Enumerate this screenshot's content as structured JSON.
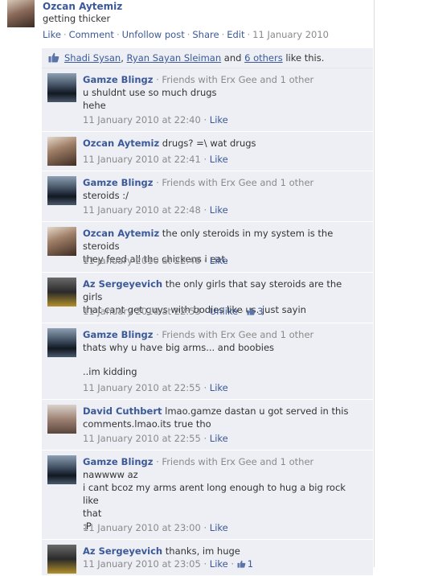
{
  "post": {
    "author": "Ozcan Aytemiz",
    "text": "getting thicker",
    "actions": [
      "Like",
      "Comment",
      "Unfollow post",
      "Share",
      "Edit"
    ],
    "date": "11 January 2010"
  },
  "likes": {
    "name1": "Shadi Sysan",
    "name2": "Ryan Sayan Sleiman",
    "connector": " and ",
    "others": "6 others",
    "suffix": " like this."
  },
  "comments": [
    {
      "author": "Gamze Blingz",
      "meta": " · Friends with Erx Gee and 1 other",
      "lines": [
        "u shuldnt use so much drugs",
        "hehe"
      ],
      "time": "11 January 2010 at 22:40",
      "action": "Like",
      "likes": ""
    },
    {
      "author": "Ozcan Aytemiz",
      "meta": "",
      "inline": " drugs? =\\ wat drugs",
      "lines": [],
      "time": "11 January 2010 at 22:41",
      "action": "Like",
      "likes": ""
    },
    {
      "author": "Gamze Blingz",
      "meta": " · Friends with Erx Gee and 1 other",
      "lines": [
        "steroids :/"
      ],
      "time": "11 January 2010 at 22:48",
      "action": "Like",
      "likes": ""
    },
    {
      "author": "Ozcan Aytemiz",
      "meta": "",
      "inline": " the only steroids in my system is the steroids",
      "lines": [
        "they feed all the chickens i eat."
      ],
      "time": "11 January 2010 at 22:48",
      "action": "Like",
      "likes": ""
    },
    {
      "author": "Az Sergeyevich",
      "meta": "",
      "inline": " the only girls that say steroids are the girls",
      "lines": [
        "that cant get guys with bodies like us. just sayin"
      ],
      "time": "11 January 2010 at 22:53",
      "action": "Unlike",
      "likes": "3"
    },
    {
      "author": "Gamze Blingz",
      "meta": " · Friends with Erx Gee and 1 other",
      "lines": [
        "thats why u have big arms... and boobies",
        "",
        "..im kidding"
      ],
      "time": "11 January 2010 at 22:55",
      "action": "Like",
      "likes": ""
    },
    {
      "author": "David Cuthbert",
      "meta": "",
      "inline": " lmao.gamze dastan u got served in this",
      "lines": [
        "comments.lmao.its true tho"
      ],
      "time": "11 January 2010 at 22:55",
      "action": "Like",
      "likes": ""
    },
    {
      "author": "Gamze Blingz",
      "meta": " · Friends with Erx Gee and 1 other",
      "lines": [
        "nawwww az",
        "i cant bcoz my arms arent long enough to hug a big rock like",
        "that",
        ":P"
      ],
      "time": "11 January 2010 at 23:00",
      "action": "Like",
      "likes": ""
    },
    {
      "author": "Az Sergeyevich",
      "meta": "",
      "inline": " thanks, im huge",
      "lines": [],
      "time": "11 January 2010 at 23:05",
      "action": "Like",
      "likes": "1"
    }
  ]
}
